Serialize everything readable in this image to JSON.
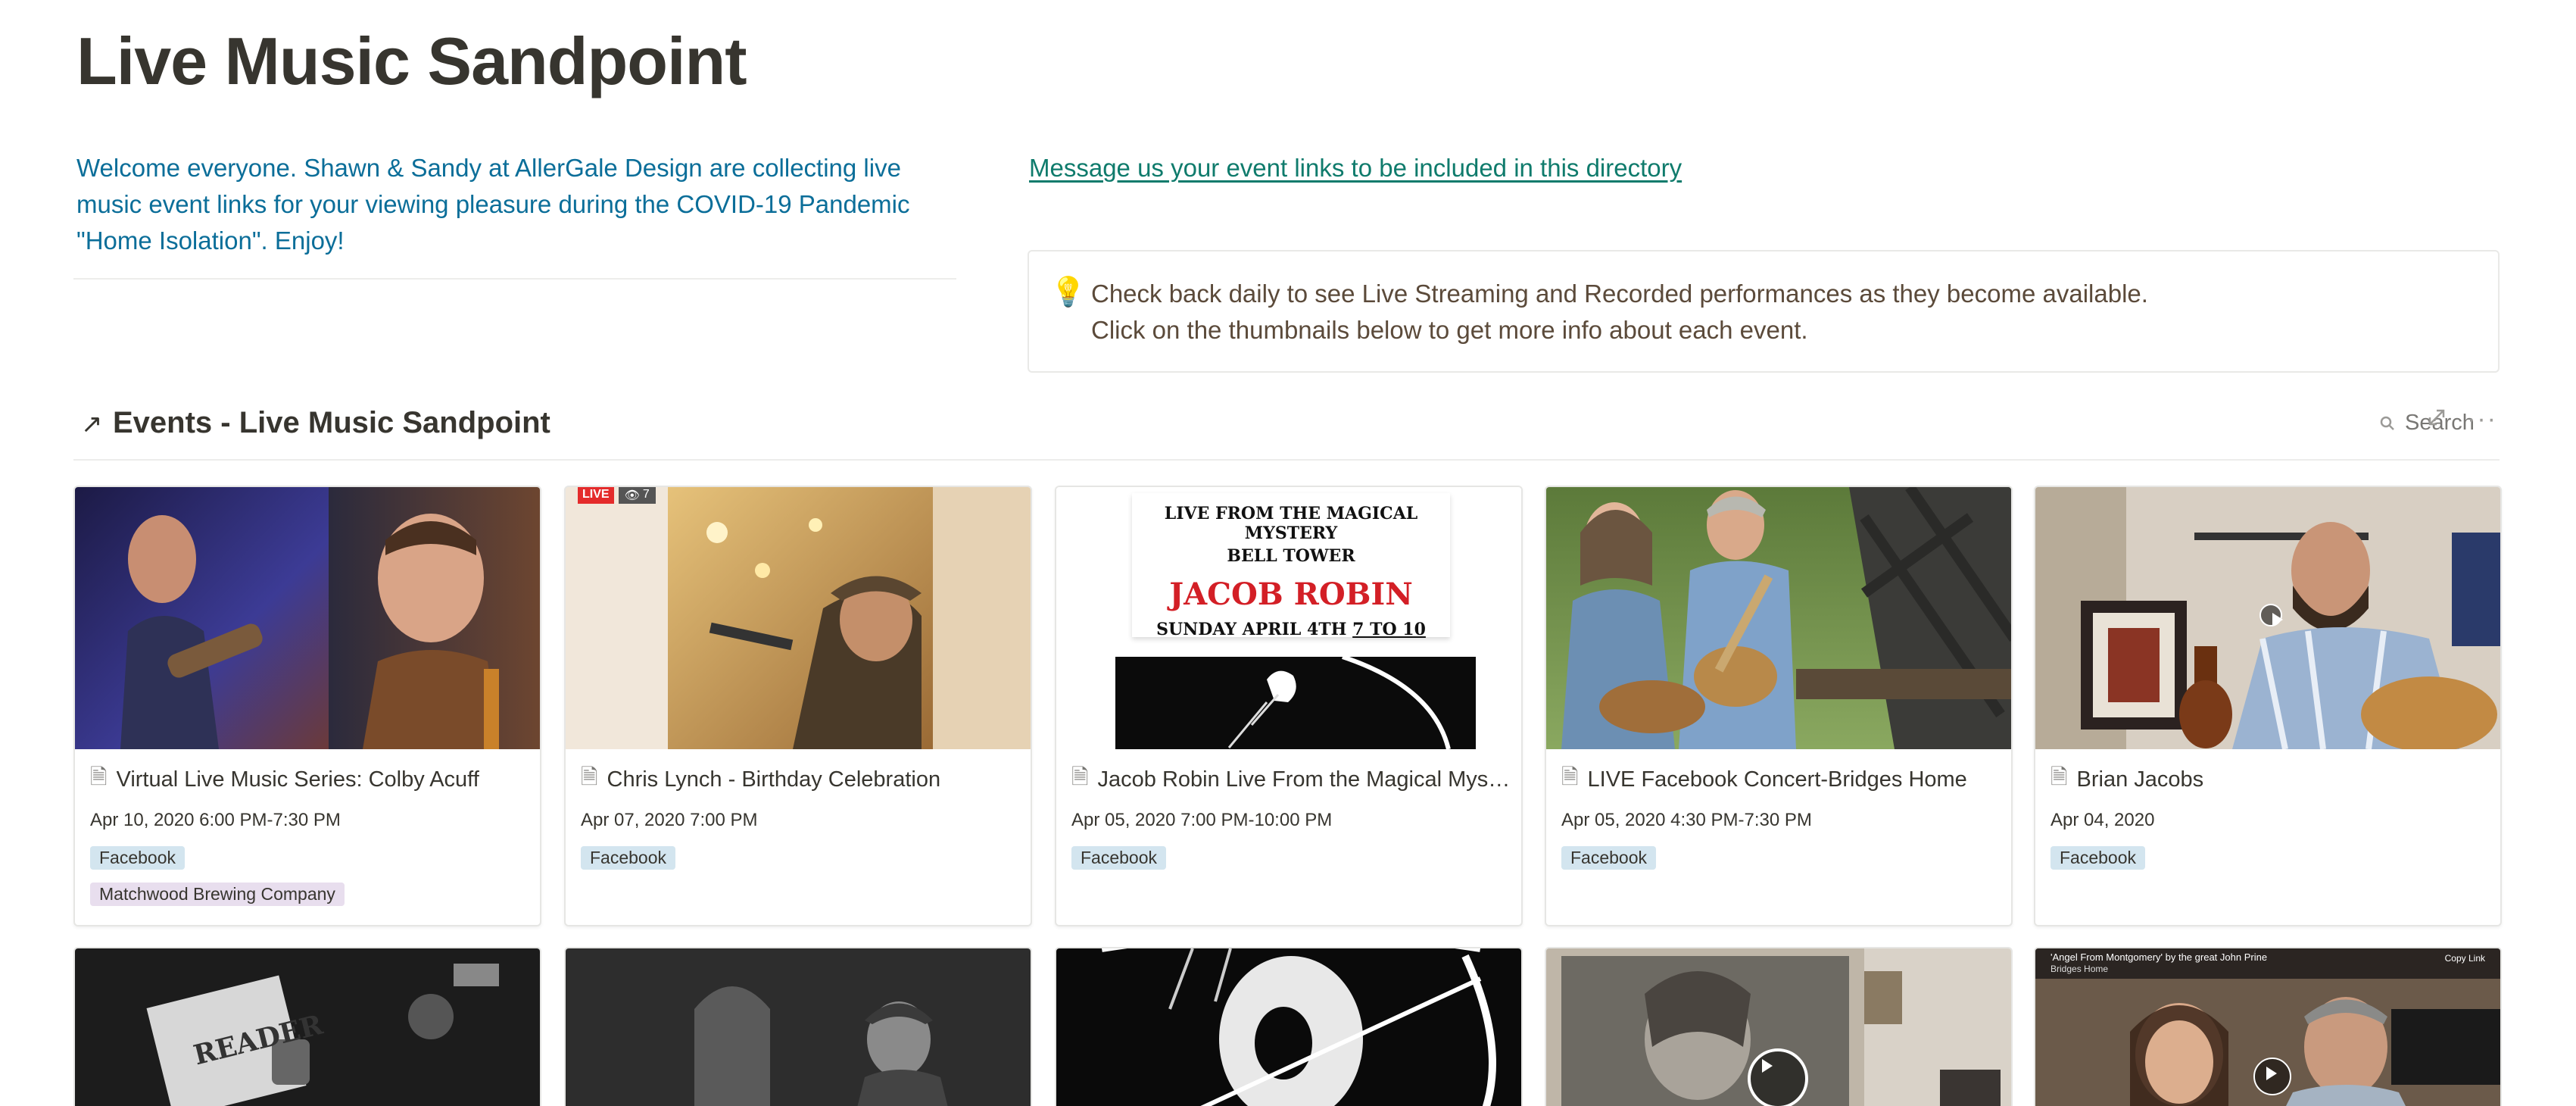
{
  "page": {
    "title": "Live Music Sandpoint",
    "welcome_text": "Welcome everyone. Shawn & Sandy at AllerGale Design are collecting live music event links for your viewing pleasure during the COVID-19 Pandemic \"Home Isolation\". Enjoy!",
    "message_link": "Message us your event links to be included in this directory"
  },
  "callout": {
    "icon": "lightbulb-icon",
    "line1": "Check back daily to see Live Streaming and Recorded performances as they become available.",
    "line2": "Click on the thumbnails below to get more info about each event."
  },
  "database": {
    "arrow": "↗",
    "title": "Events - Live Music Sandpoint",
    "search_label": "Search",
    "more": "···"
  },
  "events": [
    {
      "title": "Virtual Live Music Series: Colby Acuff",
      "date": "Apr 10, 2020 6:00 PM-7:30 PM",
      "tags": [
        "Facebook",
        "Matchwood Brewing Company"
      ]
    },
    {
      "title": "Chris Lynch - Birthday Celebration",
      "date": "Apr 07, 2020 7:00 PM",
      "tags": [
        "Facebook"
      ],
      "thumb_badge_live": "LIVE",
      "thumb_badge_views": "7"
    },
    {
      "title": "Jacob Robin Live From the Magical Mystery Bell Tower",
      "date": "Apr 05, 2020 7:00 PM-10:00 PM",
      "tags": [
        "Facebook"
      ],
      "poster_line1": "LIVE FROM THE MAGICAL MYSTERY",
      "poster_line2": "BELL TOWER",
      "poster_name": "JACOB ROBIN",
      "poster_date": "SUNDAY APRIL 4TH",
      "poster_time": "7 TO 10"
    },
    {
      "title": "LIVE Facebook Concert-Bridges Home",
      "date": "Apr 05, 2020 4:30 PM-7:30 PM",
      "tags": [
        "Facebook"
      ]
    },
    {
      "title": "Brian Jacobs",
      "date": "Apr 04, 2020",
      "tags": [
        "Facebook"
      ]
    }
  ],
  "second_row": {
    "card1_text": "READER",
    "card5_caption": "'Angel From Montgomery' by the great John Prine",
    "card5_sub": "Bridges Home",
    "card5_copy": "Copy Link"
  }
}
